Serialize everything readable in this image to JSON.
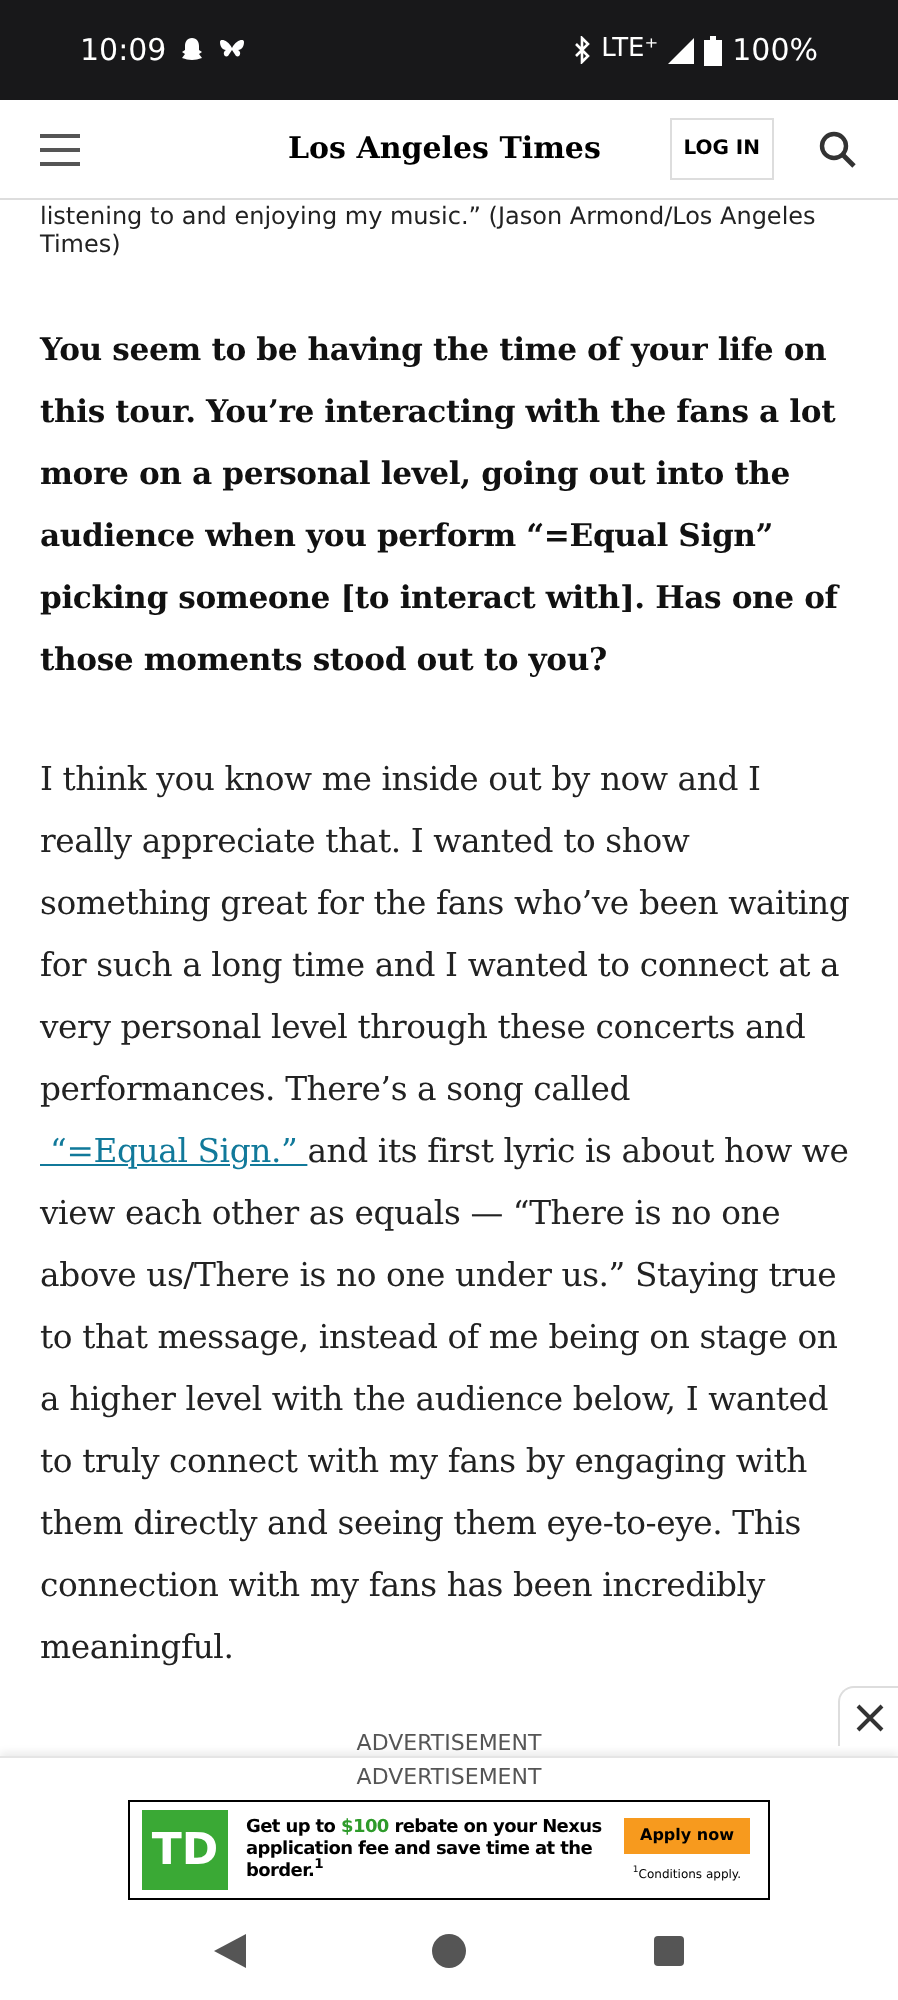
{
  "status_bar": {
    "time": "10:09",
    "network": "LTE⁺",
    "battery": "100%"
  },
  "header": {
    "logo": "Los Angeles Times",
    "login": "LOG IN"
  },
  "caption": [
    "listening to and enjoying my music.”  (Jason Armond/Los Angeles",
    "Times)"
  ],
  "question": "You seem to be having the time of your life on this tour. You’re interacting with the fans a lot more on a personal level, going out into the audience when you perform “=Equal Sign” picking someone [to interact with]. Has one of those moments stood out to you?",
  "answer": [
    {
      "kind": "text",
      "text": "I think you know me inside out by now and I really appreciate that. I wanted to show something great for the fans who’ve been waiting for such a long time and I wanted to connect at a very personal level through these concerts and performances. There’s a song called"
    },
    {
      "kind": "link",
      "text": " “=Equal Sign.” "
    },
    {
      "kind": "text",
      "text": "and its first lyric is about how we view each other as equals — “There is no one above us/There is no one under us.” Staying true to that message, instead of me being on stage on a higher level with the audience below, I wanted to truly connect with my fans by engaging with them directly and seeing them eye-to-eye. This connection with my fans has been incredibly meaningful."
    }
  ],
  "ad": {
    "label_behind": "ADVERTISEMENT",
    "label": "ADVERTISEMENT",
    "logo": "TD",
    "headline": "Get up to **$100** rebate on your Nexus application fee and save time at the border.$^{1}$",
    "button": "Apply now",
    "footnote": "$^{1}$Conditions apply."
  }
}
